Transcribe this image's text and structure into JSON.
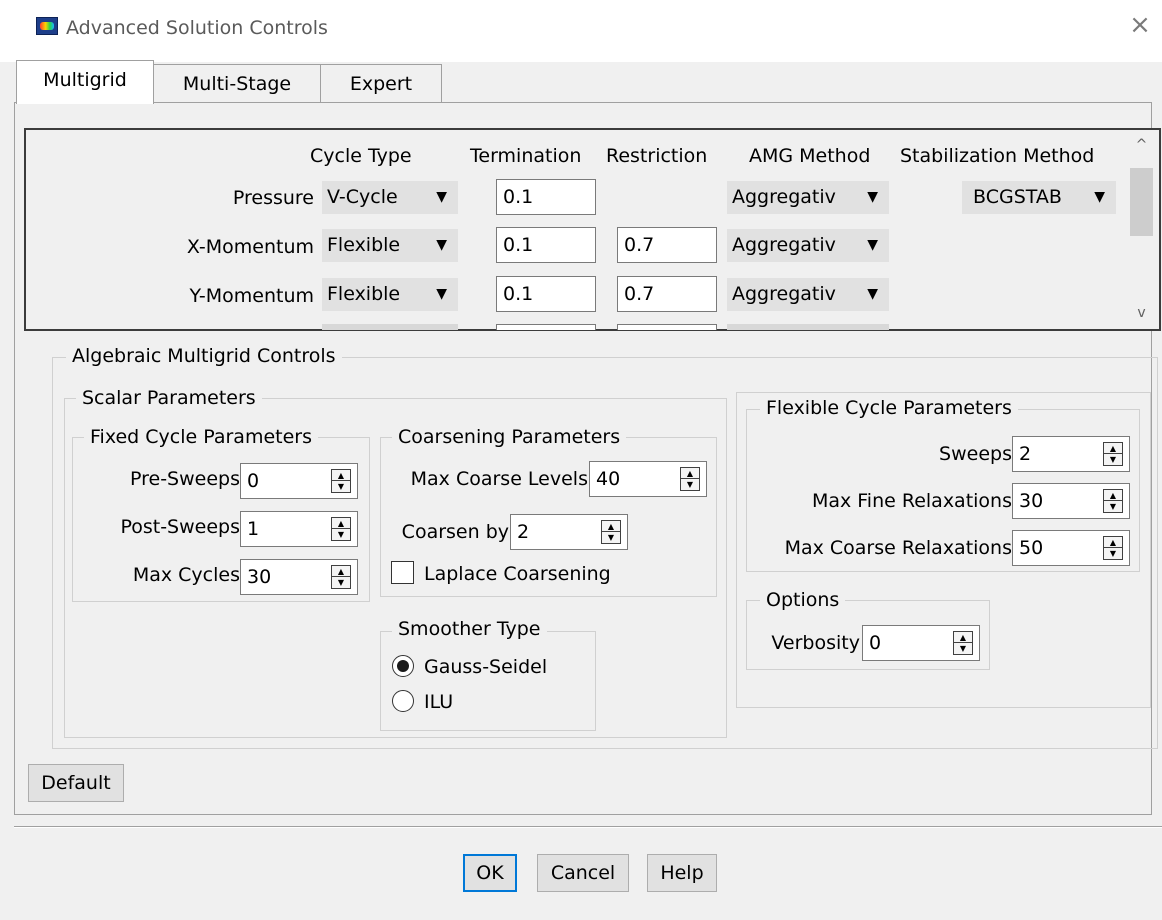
{
  "window": {
    "title": "Advanced Solution Controls",
    "close_glyph": "×",
    "icon": "ansys-fluent-icon"
  },
  "tabs": [
    {
      "label": "Multigrid",
      "active": true
    },
    {
      "label": "Multi-Stage",
      "active": false
    },
    {
      "label": "Expert",
      "active": false
    }
  ],
  "equations": {
    "headers": {
      "cycle_type": "Cycle Type",
      "termination": "Termination",
      "restriction": "Restriction",
      "amg_method": "AMG Method",
      "stabilization": "Stabilization Method"
    },
    "arrow_glyph": "▼",
    "rows": [
      {
        "name": "Pressure",
        "cycle": "V-Cycle",
        "termination": "0.1",
        "restriction": "",
        "amg": "Aggregativ",
        "stabilization": "BCGSTAB"
      },
      {
        "name": "X-Momentum",
        "cycle": "Flexible",
        "termination": "0.1",
        "restriction": "0.7",
        "amg": "Aggregativ",
        "stabilization": ""
      },
      {
        "name": "Y-Momentum",
        "cycle": "Flexible",
        "termination": "0.1",
        "restriction": "0.7",
        "amg": "Aggregativ",
        "stabilization": ""
      }
    ],
    "scrollbar": {
      "up": "^",
      "down": "v"
    }
  },
  "amg": {
    "title": "Algebraic Multigrid Controls",
    "scalar": {
      "title": "Scalar Parameters",
      "fixed": {
        "title": "Fixed Cycle Parameters",
        "pre_sweeps_label": "Pre-Sweeps",
        "pre_sweeps": "0",
        "post_sweeps_label": "Post-Sweeps",
        "post_sweeps": "1",
        "max_cycles_label": "Max Cycles",
        "max_cycles": "30"
      },
      "coarsening": {
        "title": "Coarsening Parameters",
        "max_levels_label": "Max Coarse Levels",
        "max_levels": "40",
        "coarsen_by_label": "Coarsen by",
        "coarsen_by": "2",
        "laplace_label": "Laplace Coarsening",
        "laplace_checked": false
      },
      "smoother": {
        "title": "Smoother Type",
        "options": [
          "Gauss-Seidel",
          "ILU"
        ],
        "selected": "Gauss-Seidel"
      }
    },
    "flexible": {
      "title": "Flexible Cycle Parameters",
      "sweeps_label": "Sweeps",
      "sweeps": "2",
      "max_fine_label": "Max Fine Relaxations",
      "max_fine": "30",
      "max_coarse_label": "Max Coarse Relaxations",
      "max_coarse": "50"
    },
    "options": {
      "title": "Options",
      "verbosity_label": "Verbosity",
      "verbosity": "0"
    }
  },
  "buttons": {
    "default": "Default",
    "ok": "OK",
    "cancel": "Cancel",
    "help": "Help"
  },
  "spinner": {
    "up": "▲",
    "down": "▼"
  },
  "colors": {
    "background": "#f0f0f0",
    "field": "#ffffff",
    "combo": "#e1e1e1",
    "focus_border": "#0078d7"
  }
}
